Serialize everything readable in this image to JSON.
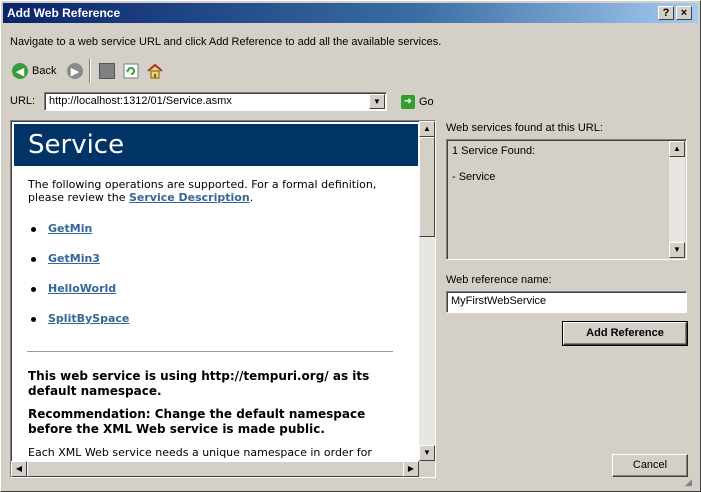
{
  "window": {
    "title": "Add Web Reference",
    "help_glyph": "?",
    "close_glyph": "×"
  },
  "instruction": "Navigate to a web service URL and click Add Reference to add all the available services.",
  "toolbar": {
    "back_label": "Back",
    "back_icon": "back-arrow-icon",
    "forward_icon": "forward-arrow-icon",
    "stop_icon": "stop-icon",
    "refresh_icon": "refresh-icon",
    "home_icon": "home-icon"
  },
  "url": {
    "label": "URL:",
    "value": "http://localhost:1312/01/Service.asmx",
    "go_label": "Go"
  },
  "browser_page": {
    "heading": "Service",
    "intro_text": "The following operations are supported. For a formal definition, please review the ",
    "service_description_link": "Service Description",
    "intro_end": ".",
    "operations": [
      "GetMin",
      "GetMin3",
      "HelloWorld",
      "SplitBySpace"
    ],
    "note1": "This web service is using http://tempuri.org/ as its default namespace.",
    "note2": "Recommendation: Change the default namespace before the XML Web service is made public.",
    "body_text": "Each XML Web service needs a unique namespace in order for"
  },
  "found": {
    "label": "Web services found at this URL:",
    "line1": "1 Service Found:",
    "line2": "- Service"
  },
  "reference_name": {
    "label": "Web reference name:",
    "value": "MyFirstWebService"
  },
  "buttons": {
    "add_reference": "Add Reference",
    "cancel": "Cancel"
  },
  "colors": {
    "title_bar": "#0a246a",
    "page_header": "#003366",
    "link": "#336699",
    "go_green": "#2e9e2e"
  }
}
